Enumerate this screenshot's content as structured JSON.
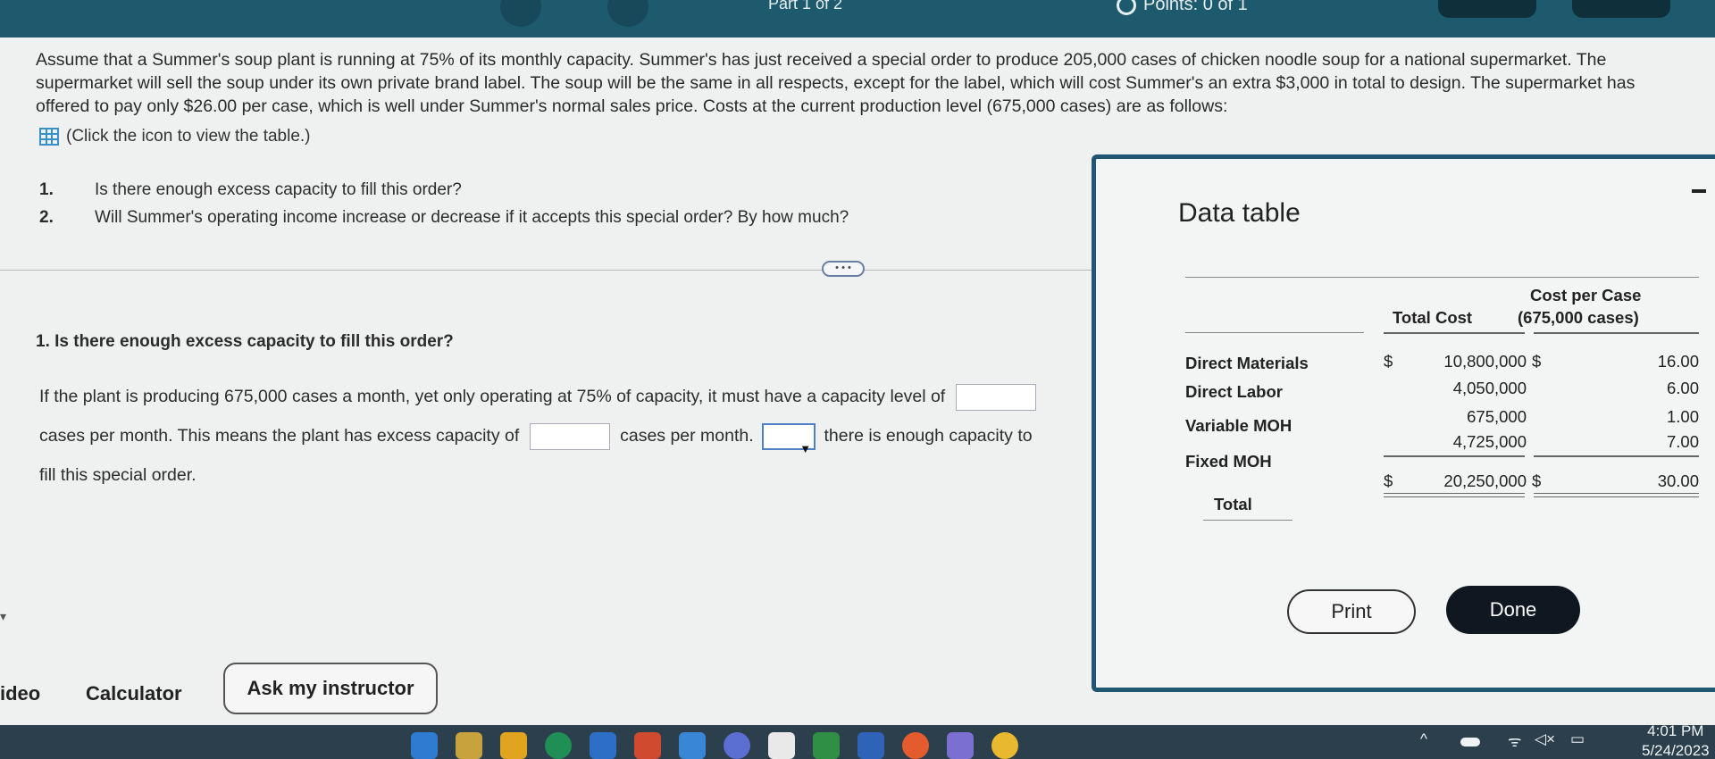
{
  "header": {
    "part": "Part 1 of 2",
    "points": "Points: 0 of 1"
  },
  "problem": {
    "text": "Assume that a Summer's soup plant is running at 75% of its monthly capacity. Summer's has just received a special order to produce 205,000 cases of chicken noodle soup for a national supermarket. The supermarket will sell the soup under its own private brand label. The soup will be the same in all respects, except for the label, which will cost Summer's an extra $3,000 in total to design. The supermarket has offered to pay only $26.00 per case, which is well under Summer's normal sales price. Costs at the current production level (675,000 cases) are as follows:",
    "table_link": "(Click the icon to view the table.)",
    "questions": [
      {
        "num": "1.",
        "text": "Is there enough excess capacity to fill this order?"
      },
      {
        "num": "2.",
        "text": "Will Summer's operating income increase or decrease if it accepts this special order? By how much?"
      }
    ],
    "more_button": "• • •"
  },
  "part1": {
    "heading": "1. Is there enough excess capacity to fill this order?",
    "sentence_a": "If the plant is producing 675,000 cases a month, yet only operating at 75% of capacity, it must have a capacity level of",
    "sentence_b": "cases per month. This means the plant has excess capacity of",
    "sentence_c": "cases per month.",
    "sentence_d": "there is enough capacity to",
    "sentence_e": "fill this special order.",
    "capacity_input": "",
    "excess_input": "",
    "yes_no_select": ""
  },
  "bottom": {
    "video": "ideo",
    "calculator": "Calculator",
    "ask": "Ask my instructor"
  },
  "modal": {
    "title": "Data table",
    "col_total": "Total Cost",
    "col_per_case_1": "Cost per Case",
    "col_per_case_2": "(675,000 cases)",
    "rows": [
      {
        "label": "Direct Materials",
        "dollar1": "$",
        "total": "10,800,000",
        "dollar2": "$",
        "per_case": "16.00"
      },
      {
        "label": "Direct Labor",
        "dollar1": "",
        "total": "4,050,000",
        "dollar2": "",
        "per_case": "6.00"
      },
      {
        "label": "Variable MOH",
        "dollar1": "",
        "total": "675,000",
        "dollar2": "",
        "per_case": "1.00"
      },
      {
        "label": "Fixed MOH",
        "dollar1": "",
        "total": "4,725,000",
        "dollar2": "",
        "per_case": "7.00"
      },
      {
        "label": "Total",
        "dollar1": "$",
        "total": "20,250,000",
        "dollar2": "$",
        "per_case": "30.00"
      }
    ],
    "print": "Print",
    "done": "Done"
  },
  "taskbar": {
    "time": "4:01 PM",
    "date": "5/24/2023"
  },
  "colors": {
    "header": "#1d5a6e",
    "modal_border": "#1f5672",
    "done_button": "#0f1720",
    "grid_icon": "#3b8fc7"
  }
}
